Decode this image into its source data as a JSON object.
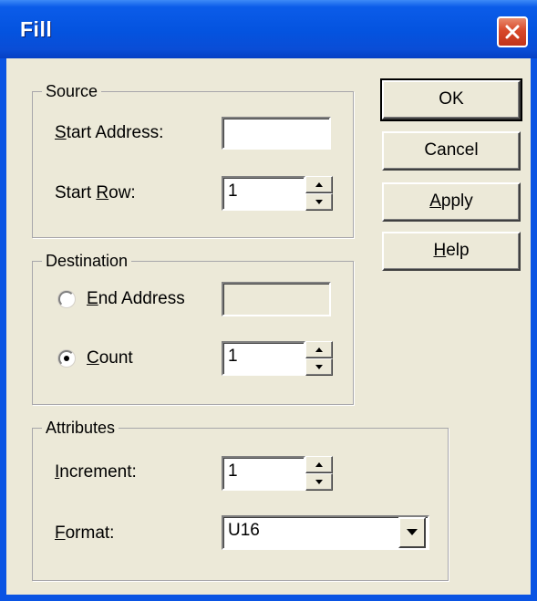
{
  "window": {
    "title": "Fill"
  },
  "source": {
    "legend": "Source",
    "start_address_label_pre": "",
    "start_address_label_key": "S",
    "start_address_label_post": "tart Address:",
    "start_address_value": "",
    "start_row_label_pre": "Start ",
    "start_row_label_key": "R",
    "start_row_label_post": "ow:",
    "start_row_value": "1"
  },
  "destination": {
    "legend": "Destination",
    "end_address_key": "E",
    "end_address_post": "nd Address",
    "end_address_value": "",
    "count_key": "C",
    "count_post": "ount",
    "count_value": "1",
    "selected": "count"
  },
  "attributes": {
    "legend": "Attributes",
    "increment_key": "I",
    "increment_post": "ncrement:",
    "increment_value": "1",
    "format_key": "F",
    "format_post": "ormat:",
    "format_value": "U16"
  },
  "buttons": {
    "ok": "OK",
    "cancel": "Cancel",
    "apply_key": "A",
    "apply_post": "pply",
    "help_key": "H",
    "help_post": "elp"
  },
  "colors": {
    "titlebar": "#0453df",
    "face": "#ece9d8",
    "close": "#d8492a"
  }
}
